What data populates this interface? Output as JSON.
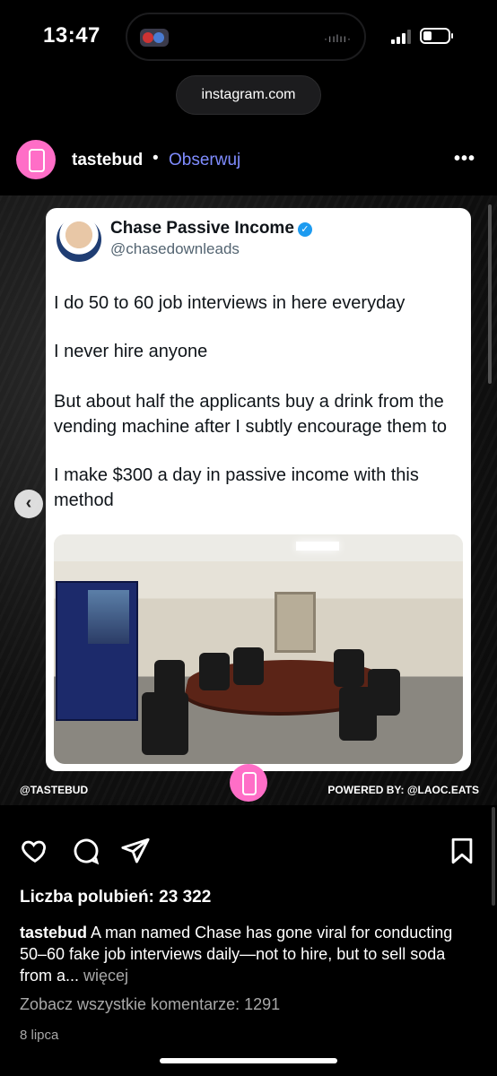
{
  "status_bar": {
    "time": "13:47",
    "battery_level": 0.3
  },
  "browser": {
    "url": "instagram.com"
  },
  "post": {
    "username": "tastebud",
    "separator": "•",
    "follow_label": "Obserwuj",
    "more_icon": "ellipsis-icon"
  },
  "media": {
    "tweet": {
      "display_name": "Chase Passive Income",
      "handle": "@chasedownleads",
      "paragraphs": [
        "I do 50 to 60 job interviews in here everyday",
        "I never hire anyone",
        "But about half the applicants buy a drink from the vending machine after I subtly encourage them to",
        "I make $300 a day in passive income with this method"
      ]
    },
    "credit_left": "@TASTEBUD",
    "credit_right": "POWERED BY: @LAOC.EATS",
    "brand_color": "#ff6ec7"
  },
  "actions": {
    "icons": [
      "heart-icon",
      "comment-icon",
      "share-icon",
      "bookmark-icon"
    ]
  },
  "likes_text": "Liczba polubień: 23 322",
  "caption": {
    "username": "tastebud",
    "text": " A man named Chase has gone viral for conducting 50–60 fake job interviews daily—not to hire, but to sell soda from a...",
    "more_label": " więcej"
  },
  "comments_link": "Zobacz wszystkie komentarze: 1291",
  "date": "8 lipca",
  "colors": {
    "link_blue": "#7f8cff",
    "verified_blue": "#1d9bf0"
  }
}
